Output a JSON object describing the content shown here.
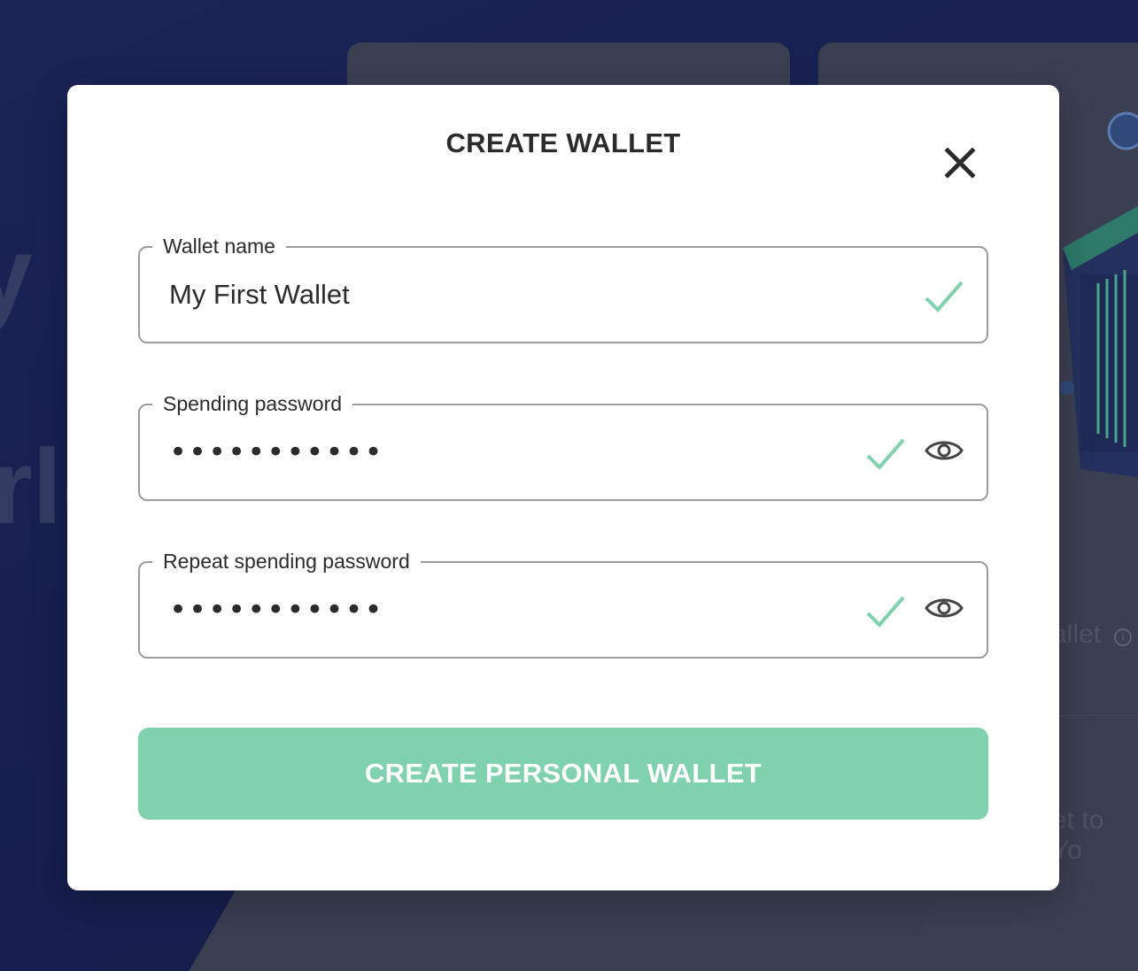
{
  "background": {
    "hero_text_1": "y",
    "hero_text_2": "rlc",
    "side_text_1": "allet",
    "side_text_2": "et to Yo",
    "info_icon": "i"
  },
  "modal": {
    "title": "CREATE WALLET",
    "close_icon": "close-icon",
    "fields": {
      "wallet_name": {
        "label": "Wallet name",
        "value": "My First Wallet",
        "valid": true
      },
      "spending_password": {
        "label": "Spending password",
        "value": "•••••••••••",
        "valid": true,
        "icon": "eye-icon"
      },
      "repeat_password": {
        "label": "Repeat spending password",
        "value": "•••••••••••",
        "valid": true,
        "icon": "eye-icon"
      }
    },
    "submit_label": "CREATE PERSONAL WALLET"
  },
  "colors": {
    "accent_green": "#80d1ad",
    "check_green": "#7fd1ae",
    "page_background": "#151f4c",
    "text_dark": "#2b2b2b"
  }
}
